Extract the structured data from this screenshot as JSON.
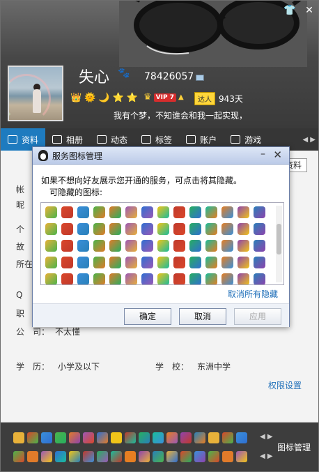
{
  "profile": {
    "nickname": "失心",
    "qq_number": "78426057",
    "vip_label": "VIP 7",
    "talent_label": "达人",
    "talent_days": "943天",
    "signature": "我有个梦，不知谁会和我一起实现，"
  },
  "tabs": [
    {
      "label": "资料",
      "active": true
    },
    {
      "label": "相册"
    },
    {
      "label": "动态"
    },
    {
      "label": "标签"
    },
    {
      "label": "账户"
    },
    {
      "label": "游戏"
    }
  ],
  "content": {
    "edit_label": "资料",
    "row_labels": [
      "帐",
      "昵",
      "个",
      "故",
      "所在",
      "Q",
      "职"
    ],
    "company_label": "公　司：",
    "company_value": "不太懂",
    "edu_label": "学　历：",
    "edu_value": "小学及以下",
    "school_label": "学　校：",
    "school_value": "东洲中学",
    "perm_link": "权限设置"
  },
  "dialog": {
    "title": "服务图标管理",
    "description": "如果不想向好友展示您开通的服务，可点击将其隐藏。",
    "hideable_label": "可隐藏的图标:",
    "cancel_hide_link": "取消所有隐藏",
    "ok_label": "确定",
    "cancel_label": "取消",
    "apply_label": "应用"
  },
  "bottom": {
    "icon_manage_label": "图标管理"
  },
  "colors": {
    "tab_active": "#1e7bbf",
    "link": "#1f6fb9",
    "vip_red": "#d62d2d",
    "talent_yellow": "#ffd63a"
  }
}
